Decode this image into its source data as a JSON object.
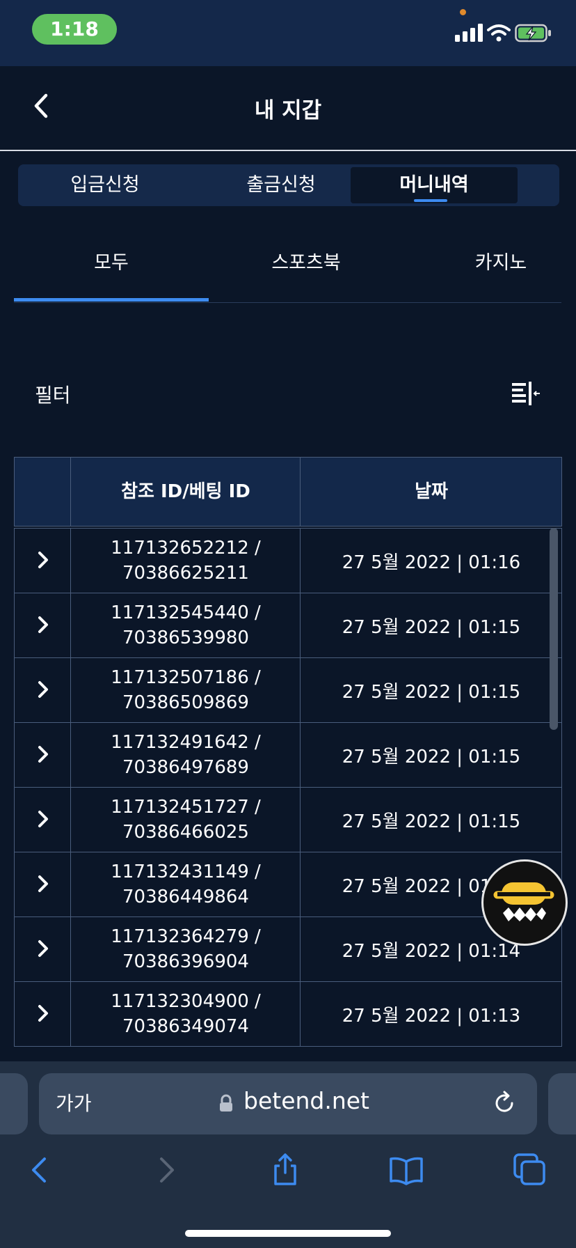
{
  "status_bar": {
    "time": "1:18"
  },
  "header": {
    "title": "내 지갑"
  },
  "main_tabs": [
    {
      "label": "입금신청"
    },
    {
      "label": "출금신청"
    },
    {
      "label": "머니내역"
    }
  ],
  "sub_tabs": [
    {
      "label": "모두"
    },
    {
      "label": "스포츠북"
    },
    {
      "label": "카지노"
    }
  ],
  "filter": {
    "label": "필터"
  },
  "table": {
    "headers": {
      "ref": "참조 ID/베팅 ID",
      "date": "날짜"
    },
    "rows": [
      {
        "ref1": "117132652212 /",
        "ref2": "70386625211",
        "date": "27 5월 2022 | 01:16"
      },
      {
        "ref1": "117132545440 /",
        "ref2": "70386539980",
        "date": "27 5월 2022 | 01:15"
      },
      {
        "ref1": "117132507186 /",
        "ref2": "70386509869",
        "date": "27 5월 2022 | 01:15"
      },
      {
        "ref1": "117132491642 /",
        "ref2": "70386497689",
        "date": "27 5월 2022 | 01:15"
      },
      {
        "ref1": "117132451727 /",
        "ref2": "70386466025",
        "date": "27 5월 2022 | 01:15"
      },
      {
        "ref1": "117132431149 /",
        "ref2": "70386449864",
        "date": "27 5월 2022 | 01:15"
      },
      {
        "ref1": "117132364279 /",
        "ref2": "70386396904",
        "date": "27 5월 2022 | 01:14"
      },
      {
        "ref1": "117132304900 /",
        "ref2": "70386349074",
        "date": "27 5월 2022 | 01:13"
      }
    ]
  },
  "browser": {
    "text_size": "가가",
    "url": "betend.net"
  },
  "colors": {
    "background": "#0b1628",
    "accent": "#3d8bf0",
    "status_green": "#5fc05f",
    "widget_yellow": "#f5c432"
  }
}
